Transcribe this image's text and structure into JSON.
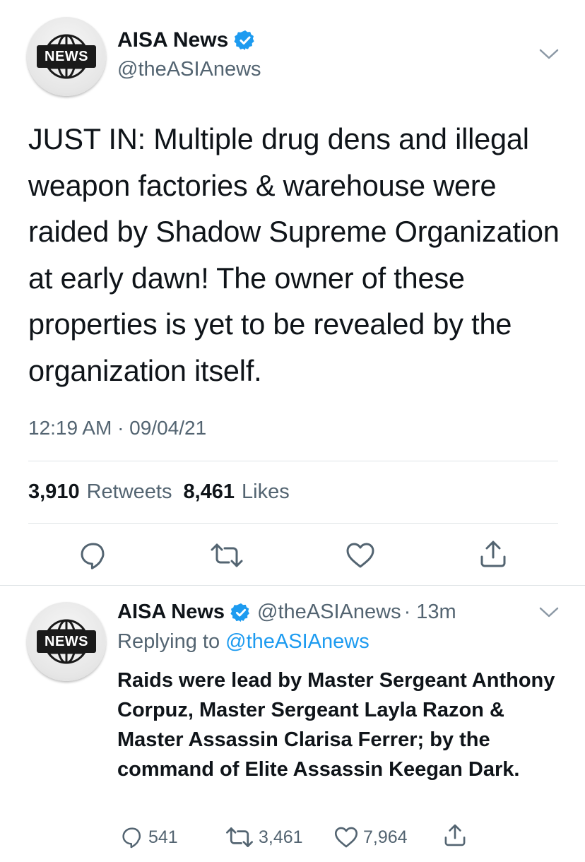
{
  "main_tweet": {
    "name": "AISA News",
    "handle": "@theASIAnews",
    "avatar_text": "NEWS",
    "text": "JUST IN: Multiple drug dens and illegal weapon factories & warehouse were raided by Shadow Supreme Organization at early dawn! The owner of these properties is yet to be revealed by the organization itself.",
    "timestamp": "12:19 AM · 09/04/21",
    "retweets_count": "3,910",
    "retweets_label": "Retweets",
    "likes_count": "8,461",
    "likes_label": "Likes"
  },
  "reply_tweet": {
    "name": "AISA News",
    "handle": "@theASIAnews",
    "time": "· 13m",
    "avatar_text": "NEWS",
    "replying_prefix": "Replying to",
    "replying_to": "@theASIAnews",
    "text": "Raids were lead by Master Sergeant Anthony Corpuz, Master Sergeant Layla Razon & Master Assassin Clarisa Ferrer; by the command of Elite Assassin Keegan Dark.",
    "reply_count": "541",
    "retweet_count": "3,461",
    "like_count": "7,964"
  },
  "icons": [
    "verified-badge-icon",
    "chevron-down-icon",
    "reply-icon",
    "retweet-icon",
    "like-icon",
    "share-icon"
  ],
  "colors": {
    "text": "#0f1419",
    "secondary": "#536471",
    "accent": "#1d9bf0",
    "divider": "#dfe3e6"
  }
}
